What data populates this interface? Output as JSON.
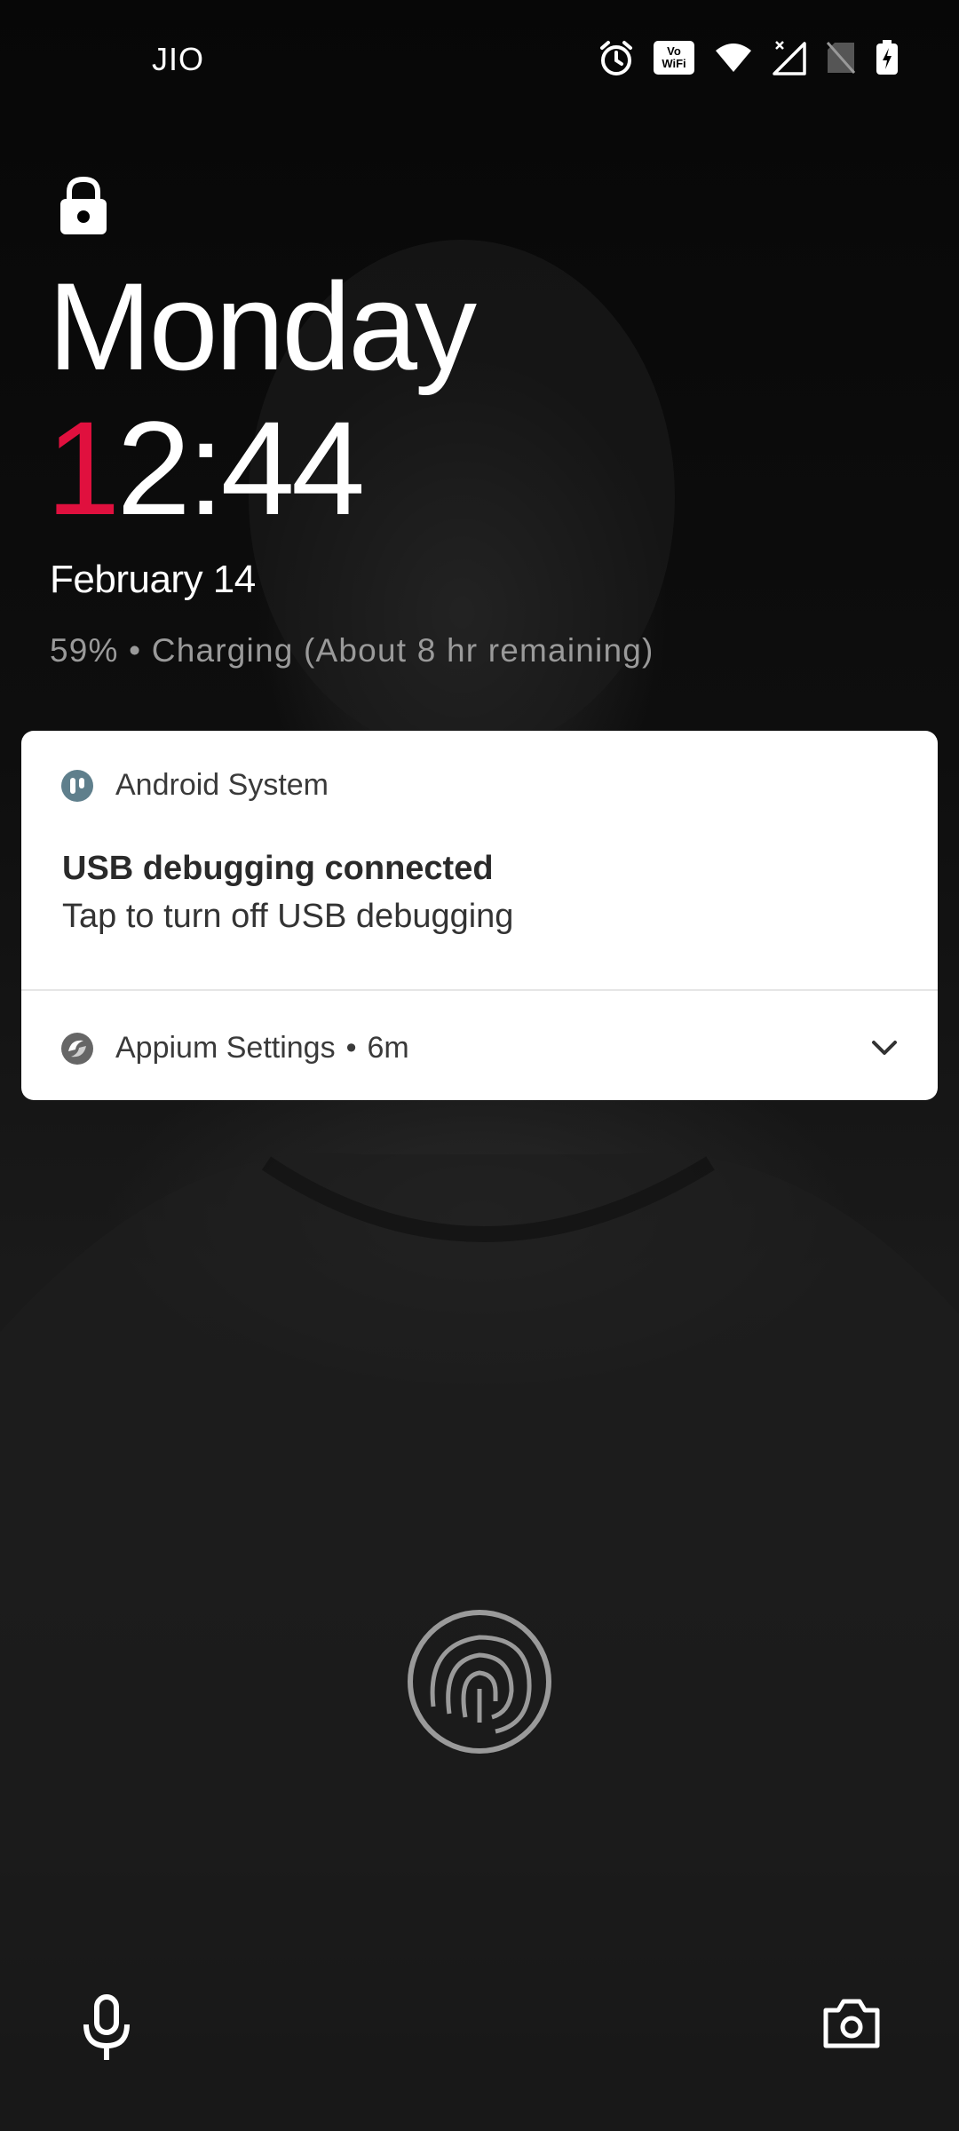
{
  "status_bar": {
    "carrier": "JIO",
    "icons": [
      "alarm-icon",
      "vowifi-icon",
      "wifi-icon",
      "mobile-signal-icon",
      "no-sim-icon",
      "battery-charging-icon"
    ],
    "vowifi_top": "Vo",
    "vowifi_bottom": "WiFi"
  },
  "lockscreen": {
    "lock_icon": "lock-icon",
    "day": "Monday",
    "time_accent": "1",
    "time_rest": "2:44",
    "date": "February 14",
    "charging_status": "59% • Charging (About 8 hr remaining)"
  },
  "notifications": [
    {
      "app": "Android System",
      "icon": "android-system-icon",
      "title": "USB debugging connected",
      "text": "Tap to turn off USB debugging"
    },
    {
      "app": "Appium Settings",
      "icon": "appium-icon",
      "time": "6m",
      "separator": "•"
    }
  ],
  "shortcuts": {
    "left": "microphone-icon",
    "right": "camera-icon",
    "center": "fingerprint-icon"
  },
  "colors": {
    "accent": "#e0103e",
    "card_bg": "#ffffff",
    "secondary_text": "#9a9a9a"
  }
}
